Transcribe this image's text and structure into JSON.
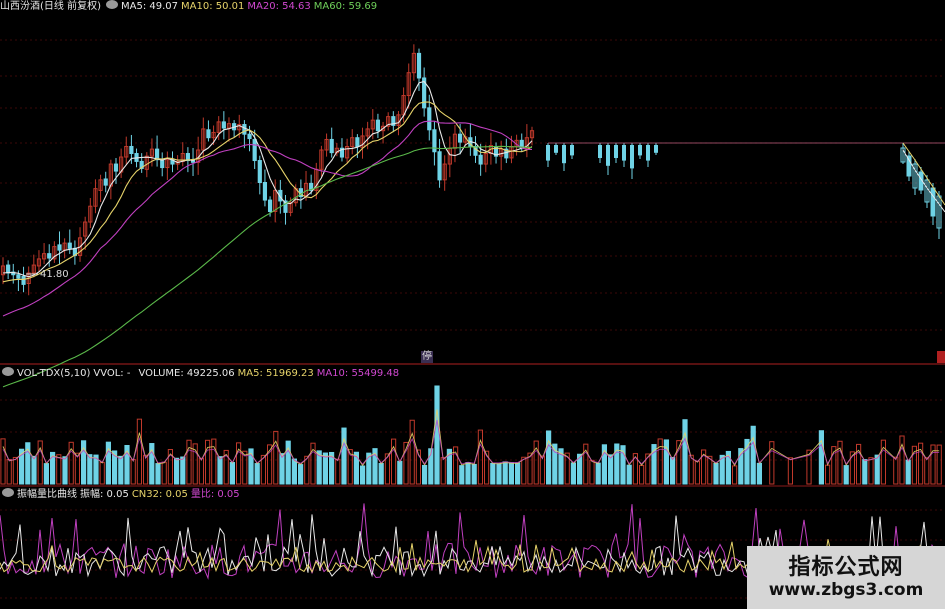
{
  "main": {
    "name": "山西汾酒(日线 前复权)",
    "ma5_label": "MA5: 49.07",
    "ma10_label": "MA10: 50.01",
    "ma20_label": "MA20: 54.63",
    "ma60_label": "MA60: 59.69",
    "low_label": "41.80",
    "halt_label": "停"
  },
  "volume": {
    "title": "VOL-TDX(5,10)",
    "vvol": "VVOL: -",
    "volume_label": "VOLUME: 49225.06",
    "ma5_label": "MA5: 51969.23",
    "ma10_label": "MA10: 55499.48"
  },
  "amplitude": {
    "title": "振幅量比曲线",
    "amp_label": "振幅: 0.05",
    "cn32_label": "CN32: 0.05",
    "ratio_label": "量比: 0.05"
  },
  "watermark": {
    "title": "指标公式网",
    "url": "www.zbgs3.com"
  },
  "colors": {
    "up": "#c0392b",
    "down": "#6fd3e6",
    "ma5": "#e8e8e8",
    "ma10": "#e6d36a",
    "ma20": "#c040c0",
    "ma60": "#5ab84a",
    "grid": "#7a1010"
  },
  "chart_data": {
    "type": "candlestick",
    "title": "山西汾酒(日线 前复权)",
    "ma": {
      "MA5": 49.07,
      "MA10": 50.01,
      "MA20": 54.63,
      "MA60": 59.69
    },
    "price_annotations": [
      {
        "label": "41.80",
        "value": 41.8
      }
    ],
    "price_range": [
      35,
      72
    ],
    "candles_open_close": [
      [
        43.0,
        44.0
      ],
      [
        44.1,
        43.2
      ],
      [
        43.3,
        43.0
      ],
      [
        43.0,
        42.6
      ],
      [
        42.8,
        41.9
      ],
      [
        42.0,
        43.2
      ],
      [
        43.2,
        44.1
      ],
      [
        44.0,
        44.8
      ],
      [
        44.8,
        45.4
      ],
      [
        45.4,
        44.9
      ],
      [
        44.8,
        46.2
      ],
      [
        46.4,
        45.8
      ],
      [
        45.8,
        46.6
      ],
      [
        46.6,
        46.0
      ],
      [
        46.0,
        45.2
      ],
      [
        45.2,
        47.2
      ],
      [
        47.4,
        49.0
      ],
      [
        49.0,
        50.8
      ],
      [
        50.8,
        52.8
      ],
      [
        52.6,
        53.8
      ],
      [
        53.9,
        53.2
      ],
      [
        53.1,
        55.6
      ],
      [
        55.6,
        54.8
      ],
      [
        54.7,
        56.4
      ],
      [
        56.4,
        57.6
      ],
      [
        57.6,
        56.8
      ],
      [
        56.8,
        55.9
      ],
      [
        55.9,
        55.1
      ],
      [
        55.0,
        56.5
      ],
      [
        56.5,
        57.3
      ],
      [
        57.3,
        56.1
      ],
      [
        56.0,
        55.2
      ],
      [
        55.2,
        56.1
      ],
      [
        56.1,
        55.6
      ],
      [
        55.6,
        55.9
      ],
      [
        55.9,
        56.8
      ],
      [
        56.8,
        56.0
      ],
      [
        56.0,
        55.8
      ],
      [
        55.8,
        57.2
      ],
      [
        57.2,
        59.6
      ],
      [
        59.5,
        58.6
      ],
      [
        58.6,
        59.2
      ],
      [
        59.2,
        60.4
      ],
      [
        60.4,
        59.7
      ],
      [
        59.7,
        60.2
      ],
      [
        60.2,
        59.5
      ],
      [
        59.5,
        60.1
      ],
      [
        60.1,
        59.0
      ],
      [
        59.0,
        58.5
      ],
      [
        58.4,
        56.0
      ],
      [
        56.0,
        53.5
      ],
      [
        53.5,
        51.5
      ],
      [
        51.5,
        50.2
      ],
      [
        50.2,
        52.6
      ],
      [
        52.6,
        51.4
      ],
      [
        51.4,
        50.1
      ],
      [
        50.1,
        51.2
      ],
      [
        51.2,
        52.8
      ],
      [
        52.8,
        51.9
      ],
      [
        52.0,
        53.4
      ],
      [
        53.4,
        52.6
      ],
      [
        52.6,
        55.0
      ],
      [
        55.0,
        57.2
      ],
      [
        57.2,
        58.4
      ],
      [
        58.4,
        56.9
      ],
      [
        56.9,
        57.4
      ],
      [
        57.4,
        56.4
      ],
      [
        56.3,
        57.6
      ],
      [
        57.6,
        58.6
      ],
      [
        58.6,
        57.6
      ],
      [
        57.5,
        58.8
      ],
      [
        58.8,
        59.6
      ],
      [
        59.6,
        60.6
      ],
      [
        60.6,
        59.4
      ],
      [
        59.4,
        59.9
      ],
      [
        59.9,
        61.0
      ],
      [
        61.0,
        60.0
      ],
      [
        60.0,
        61.2
      ],
      [
        61.2,
        63.4
      ],
      [
        63.4,
        66.0
      ],
      [
        66.0,
        68.2
      ],
      [
        68.2,
        65.4
      ],
      [
        65.4,
        62.0
      ],
      [
        62.0,
        59.5
      ],
      [
        59.5,
        57.0
      ],
      [
        57.0,
        53.8
      ],
      [
        53.8,
        55.6
      ],
      [
        55.6,
        57.4
      ],
      [
        57.4,
        59.0
      ],
      [
        59.0,
        58.1
      ],
      [
        58.1,
        58.7
      ],
      [
        58.6,
        57.6
      ],
      [
        57.6,
        56.6
      ],
      [
        56.6,
        55.6
      ],
      [
        55.6,
        56.8
      ],
      [
        56.8,
        57.7
      ],
      [
        57.6,
        56.5
      ],
      [
        56.5,
        57.3
      ],
      [
        57.3,
        56.3
      ],
      [
        56.3,
        57.6
      ],
      [
        57.6,
        58.3
      ],
      [
        58.3,
        57.4
      ],
      [
        57.4,
        58.6
      ],
      [
        58.6,
        59.4
      ]
    ],
    "volume_ma": {
      "VOLUME": 49225.06,
      "MA5": 51969.23,
      "MA10": 55499.48
    },
    "amplitude": {
      "振幅": 0.05,
      "CN32": 0.05,
      "量比": 0.05
    }
  }
}
